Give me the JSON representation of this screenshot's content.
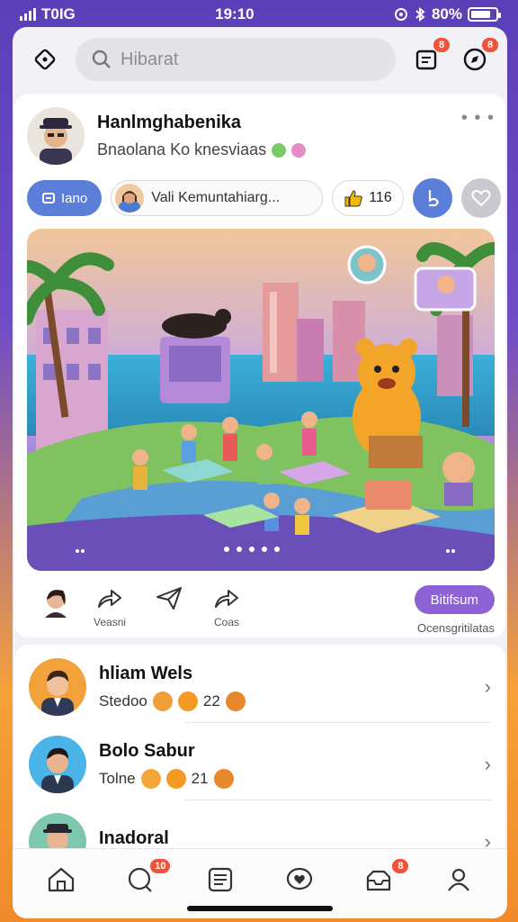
{
  "status_bar": {
    "carrier": "T0IG",
    "time": "19:10",
    "battery": "80%"
  },
  "search": {
    "placeholder": "Hibarat"
  },
  "top_bar": {
    "messages_badge": "8",
    "notifications_badge": "8"
  },
  "post": {
    "author_name": "Hanlmghabenika",
    "author_sub": "Bnaolana Ko knesviaas",
    "tag_chip": "Iano",
    "mention_chip": "Vali Kemuntahiarg...",
    "likes_count": "116",
    "follow_button": "Bitifsum",
    "follow_sub": "Ocensgritilatas",
    "actions": [
      {
        "label": "Veasni"
      },
      {
        "label": ""
      },
      {
        "label": "Coas"
      }
    ]
  },
  "list": [
    {
      "name": "hliam Wels",
      "meta": "Stedoo",
      "count": "22"
    },
    {
      "name": "Bolo Sabur",
      "meta": "Tolne",
      "count": "21"
    },
    {
      "name": "Inadoral",
      "meta": "",
      "count": ""
    }
  ],
  "tabs": [
    {
      "icon": "home-icon"
    },
    {
      "icon": "chat-icon",
      "badge": "10"
    },
    {
      "icon": "document-icon"
    },
    {
      "icon": "heart-chat-icon"
    },
    {
      "icon": "inbox-icon",
      "badge": "8"
    },
    {
      "icon": "profile-icon"
    }
  ],
  "colors": {
    "accent_blue": "#5b7fd8",
    "accent_purple": "#8d62d6",
    "badge_red": "#f0533a"
  }
}
